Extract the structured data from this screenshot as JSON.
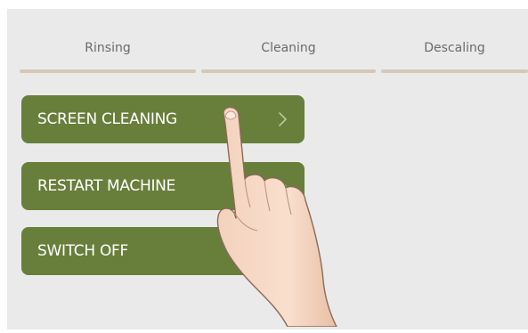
{
  "tabs": [
    {
      "label": "Rinsing"
    },
    {
      "label": "Cleaning"
    },
    {
      "label": "Descaling"
    }
  ],
  "menu": [
    {
      "label": "SCREEN CLEANING",
      "icon": "chevron-right-icon"
    },
    {
      "label": "RESTART MACHINE",
      "icon": "chevron-right-icon"
    },
    {
      "label": "SWITCH OFF"
    }
  ],
  "colors": {
    "button_bg": "#677f3b",
    "tab_underline": "#d8c7b6",
    "screen_bg": "#eaeaea"
  }
}
